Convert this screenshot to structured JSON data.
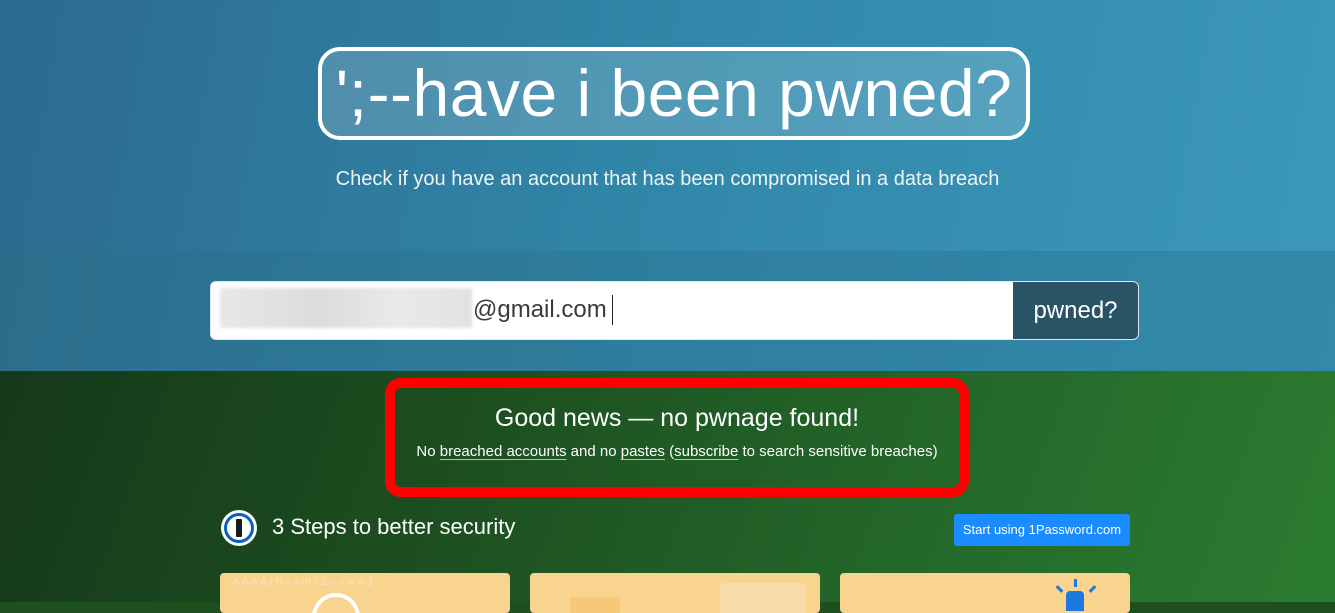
{
  "header": {
    "logo_text": "';--have i been pwned?",
    "tagline": "Check if you have an account that has been compromised in a data breach"
  },
  "search": {
    "email_visible_suffix": "@gmail.com",
    "button_label": "pwned?"
  },
  "result": {
    "title": "Good news — no pwnage found!",
    "detail_prefix": "No ",
    "breached_accounts_link": "breached accounts",
    "detail_mid": " and no ",
    "pastes_link": "pastes",
    "detail_paren_open": " (",
    "subscribe_link": "subscribe",
    "detail_suffix": " to search sensitive breaches)"
  },
  "steps": {
    "title": "3 Steps to better security",
    "cta_label": "Start using 1Password.com",
    "icon": "1password-icon"
  },
  "colors": {
    "hero_blue": "#3187a9",
    "search_button": "#2b5366",
    "result_green": "#24692a",
    "highlight_red": "#ff0000",
    "cta_blue": "#1a8cff",
    "card_yellow": "#f9d48f"
  }
}
